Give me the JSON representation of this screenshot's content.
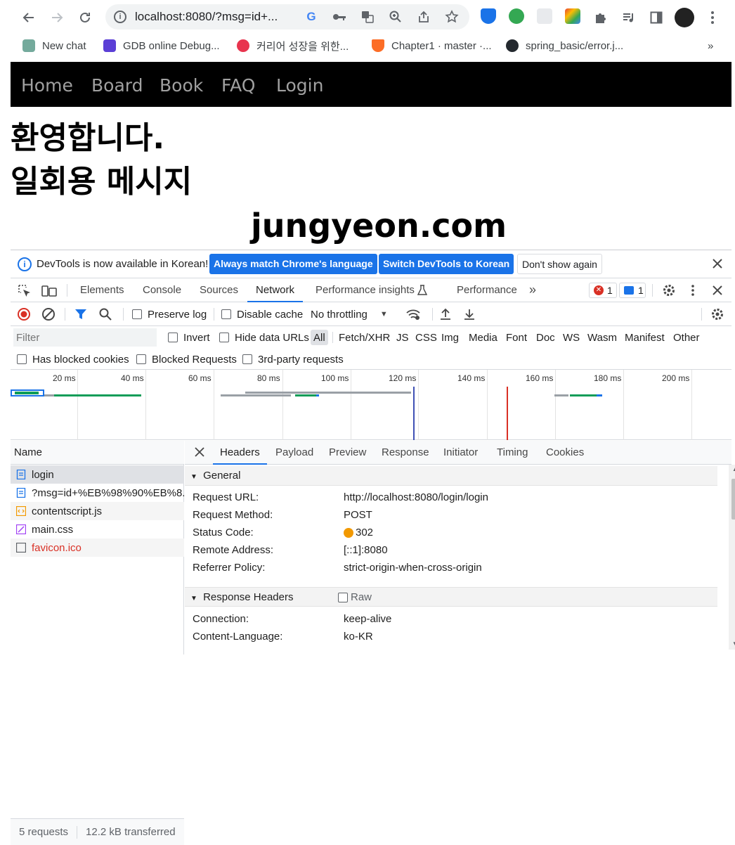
{
  "browser": {
    "url": "localhost:8080/?msg=id+...",
    "bookmarks": [
      {
        "label": "New chat",
        "color": "#74aa9c"
      },
      {
        "label": "GDB online Debug...",
        "color": "#5b3fd6"
      },
      {
        "label": "커리어 성장을 위한...",
        "color": "#e8344e"
      },
      {
        "label": "Chapter1 · master ·...",
        "color": "#fc6d26"
      },
      {
        "label": "spring_basic/error.j...",
        "color": "#24292f"
      }
    ],
    "more_bookmarks": "»"
  },
  "page": {
    "nav": [
      "Home",
      "Board",
      "Book",
      "FAQ",
      "Login"
    ],
    "heading1": "환영합니다.",
    "heading2": "일회용 메시지",
    "domain_text": "jungyeon.com"
  },
  "devtools": {
    "infobar": {
      "message": "DevTools is now available in Korean!",
      "btn_match": "Always match Chrome's language",
      "btn_switch": "Switch DevTools to Korean",
      "btn_dont_show": "Don't show again"
    },
    "tabs": [
      "Elements",
      "Console",
      "Sources",
      "Network",
      "Performance insights",
      "Performance"
    ],
    "active_tab": "Network",
    "error_count": "1",
    "message_count": "1",
    "network_toolbar": {
      "preserve_log": "Preserve log",
      "disable_cache": "Disable cache",
      "throttling": "No throttling"
    },
    "filter": {
      "placeholder": "Filter",
      "invert": "Invert",
      "hide_data_urls": "Hide data URLs",
      "types": [
        "All",
        "Fetch/XHR",
        "JS",
        "CSS",
        "Img",
        "Media",
        "Font",
        "Doc",
        "WS",
        "Wasm",
        "Manifest",
        "Other"
      ],
      "has_blocked_cookies": "Has blocked cookies",
      "blocked_requests": "Blocked Requests",
      "third_party": "3rd-party requests"
    },
    "overview_ticks": [
      "20 ms",
      "40 ms",
      "60 ms",
      "80 ms",
      "100 ms",
      "120 ms",
      "140 ms",
      "160 ms",
      "180 ms",
      "200 ms"
    ],
    "name_header": "Name",
    "requests": [
      {
        "name": "login",
        "type": "doc",
        "color": "#1f1f1f"
      },
      {
        "name": "?msg=id+%EB%98%90%EB%8...",
        "type": "doc",
        "color": "#1f1f1f"
      },
      {
        "name": "contentscript.js",
        "type": "script",
        "color": "#1f1f1f"
      },
      {
        "name": "main.css",
        "type": "css",
        "color": "#1f1f1f"
      },
      {
        "name": "favicon.ico",
        "type": "other",
        "color": "#d93025"
      }
    ],
    "summary": {
      "requests": "5 requests",
      "transferred": "12.2 kB transferred"
    },
    "detail_tabs": [
      "Headers",
      "Payload",
      "Preview",
      "Response",
      "Initiator",
      "Timing",
      "Cookies"
    ],
    "active_detail_tab": "Headers",
    "general": {
      "title": "General",
      "rows": [
        {
          "key": "Request URL:",
          "value": "http://localhost:8080/login/login"
        },
        {
          "key": "Request Method:",
          "value": "POST"
        },
        {
          "key": "Status Code:",
          "value": "302"
        },
        {
          "key": "Remote Address:",
          "value": "[::1]:8080"
        },
        {
          "key": "Referrer Policy:",
          "value": "strict-origin-when-cross-origin"
        }
      ]
    },
    "response_headers": {
      "title": "Response Headers",
      "raw_label": "Raw",
      "rows": [
        {
          "key": "Connection:",
          "value": "keep-alive"
        },
        {
          "key": "Content-Language:",
          "value": "ko-KR"
        }
      ]
    }
  }
}
